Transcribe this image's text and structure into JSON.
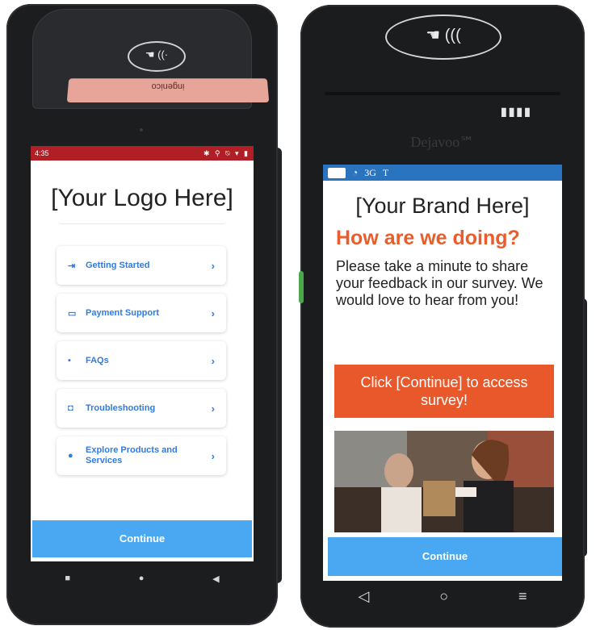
{
  "left_device": {
    "brand": "ingenico",
    "status_time": "4:35",
    "status_icons": "✱ ⚲ ⍉ ▾ ▮",
    "logo_text": "[Your Logo Here]",
    "menu": [
      {
        "label": "Getting Started",
        "icon": "login-icon"
      },
      {
        "label": "Payment Support",
        "icon": "card-icon"
      },
      {
        "label": "FAQs",
        "icon": "chat-icon"
      },
      {
        "label": "Troubleshooting",
        "icon": "settings-box-icon"
      },
      {
        "label": "Explore Products and Services",
        "icon": "compass-icon"
      }
    ],
    "continue_label": "Continue",
    "accent": "#2f7be0",
    "status_bar_color": "#b01f25",
    "button_color": "#4aa8f2"
  },
  "right_device": {
    "brand_logo": "Dejavoo℠",
    "network": "3G",
    "carrier": "T",
    "brand_text": "[Your Brand Here]",
    "heading": "How are we doing?",
    "body": "Please take a minute to share your feedback in our survey. We would love to hear from you!",
    "cta_label": "Click [Continue] to access survey!",
    "continue_label": "Continue",
    "heading_color": "#e85d2b",
    "cta_color": "#e8582a",
    "status_bar_color": "#2a73bf",
    "button_color": "#4aa8f2"
  }
}
